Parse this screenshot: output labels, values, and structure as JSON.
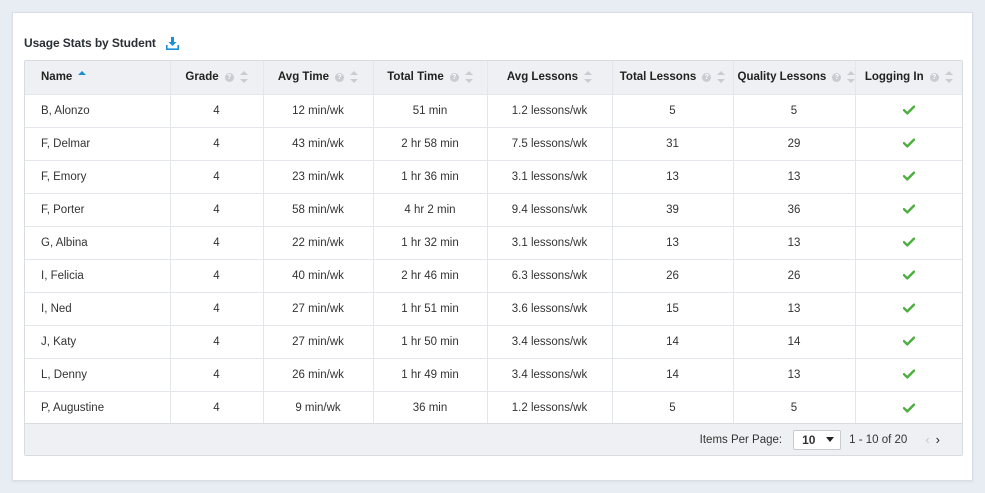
{
  "card": {
    "title": "Usage Stats by Student",
    "download_icon": "download-icon"
  },
  "columns": [
    {
      "key": "name",
      "label": "Name",
      "help": false,
      "sort": "asc"
    },
    {
      "key": "grade",
      "label": "Grade",
      "help": true,
      "sort": "none"
    },
    {
      "key": "avg_time",
      "label": "Avg Time",
      "help": true,
      "sort": "none"
    },
    {
      "key": "total_time",
      "label": "Total Time",
      "help": true,
      "sort": "none"
    },
    {
      "key": "avg_lessons",
      "label": "Avg Lessons",
      "help": false,
      "sort": "none"
    },
    {
      "key": "total_lessons",
      "label": "Total Lessons",
      "help": true,
      "sort": "none"
    },
    {
      "key": "quality_lessons",
      "label": "Quality Lessons",
      "help": true,
      "sort": "none"
    },
    {
      "key": "logging_in",
      "label": "Logging In",
      "help": true,
      "sort": "none"
    }
  ],
  "rows": [
    {
      "name": "B, Alonzo",
      "grade": "4",
      "avg_time": "12 min/wk",
      "total_time": "51 min",
      "avg_lessons": "1.2 lessons/wk",
      "total_lessons": "5",
      "quality_lessons": "5",
      "logging_in": true
    },
    {
      "name": "F, Delmar",
      "grade": "4",
      "avg_time": "43 min/wk",
      "total_time": "2 hr 58 min",
      "avg_lessons": "7.5 lessons/wk",
      "total_lessons": "31",
      "quality_lessons": "29",
      "logging_in": true
    },
    {
      "name": "F, Emory",
      "grade": "4",
      "avg_time": "23 min/wk",
      "total_time": "1 hr 36 min",
      "avg_lessons": "3.1 lessons/wk",
      "total_lessons": "13",
      "quality_lessons": "13",
      "logging_in": true
    },
    {
      "name": "F, Porter",
      "grade": "4",
      "avg_time": "58 min/wk",
      "total_time": "4 hr 2 min",
      "avg_lessons": "9.4 lessons/wk",
      "total_lessons": "39",
      "quality_lessons": "36",
      "logging_in": true
    },
    {
      "name": "G, Albina",
      "grade": "4",
      "avg_time": "22 min/wk",
      "total_time": "1 hr 32 min",
      "avg_lessons": "3.1 lessons/wk",
      "total_lessons": "13",
      "quality_lessons": "13",
      "logging_in": true
    },
    {
      "name": "I, Felicia",
      "grade": "4",
      "avg_time": "40 min/wk",
      "total_time": "2 hr 46 min",
      "avg_lessons": "6.3 lessons/wk",
      "total_lessons": "26",
      "quality_lessons": "26",
      "logging_in": true
    },
    {
      "name": "I, Ned",
      "grade": "4",
      "avg_time": "27 min/wk",
      "total_time": "1 hr 51 min",
      "avg_lessons": "3.6 lessons/wk",
      "total_lessons": "15",
      "quality_lessons": "13",
      "logging_in": true
    },
    {
      "name": "J, Katy",
      "grade": "4",
      "avg_time": "27 min/wk",
      "total_time": "1 hr 50 min",
      "avg_lessons": "3.4 lessons/wk",
      "total_lessons": "14",
      "quality_lessons": "14",
      "logging_in": true
    },
    {
      "name": "L, Denny",
      "grade": "4",
      "avg_time": "26 min/wk",
      "total_time": "1 hr 49 min",
      "avg_lessons": "3.4 lessons/wk",
      "total_lessons": "14",
      "quality_lessons": "13",
      "logging_in": true
    },
    {
      "name": "P, Augustine",
      "grade": "4",
      "avg_time": "9 min/wk",
      "total_time": "36 min",
      "avg_lessons": "1.2 lessons/wk",
      "total_lessons": "5",
      "quality_lessons": "5",
      "logging_in": true
    }
  ],
  "footer": {
    "items_per_page_label": "Items Per Page:",
    "items_per_page_value": "10",
    "range_text": "1 - 10 of 20",
    "prev_icon": "chevron-left-icon",
    "next_icon": "chevron-right-icon"
  },
  "colors": {
    "accent": "#1a8fd6",
    "check": "#4caf3f",
    "header_bg": "#eef0f3"
  }
}
